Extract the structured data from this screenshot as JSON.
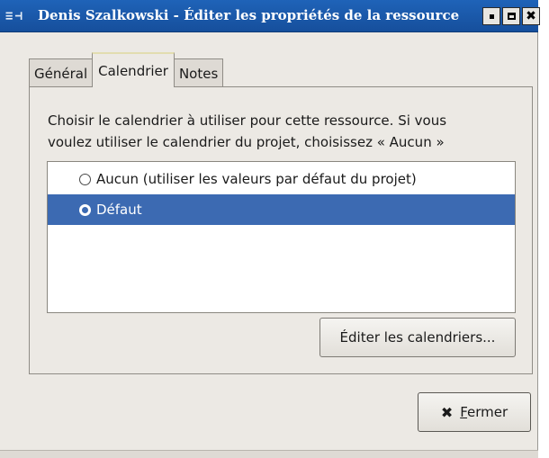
{
  "window": {
    "title": "Denis Szalkowski - Éditer les propriétés de la ressource",
    "controls": {
      "minimize": "▪",
      "close": "✖"
    }
  },
  "tabs": [
    {
      "label": "Général",
      "active": false
    },
    {
      "label": "Calendrier",
      "active": true
    },
    {
      "label": "Notes",
      "active": false
    }
  ],
  "calendar": {
    "description_line1": "Choisir le calendrier à utiliser pour cette ressource. Si vous",
    "description_line2": "voulez utiliser le calendrier du projet, choisissez « Aucun »",
    "options": [
      {
        "label": "Aucun (utiliser les valeurs par défaut du projet)",
        "selected": false
      },
      {
        "label": "Défaut",
        "selected": true
      }
    ],
    "edit_button": "Éditer les calendriers..."
  },
  "footer": {
    "close_button_mnemonic": "F",
    "close_button_rest": "ermer"
  },
  "colors": {
    "titlebar": "#1f63b8",
    "selection": "#3c6ab2",
    "window_bg": "#ece9e4"
  }
}
